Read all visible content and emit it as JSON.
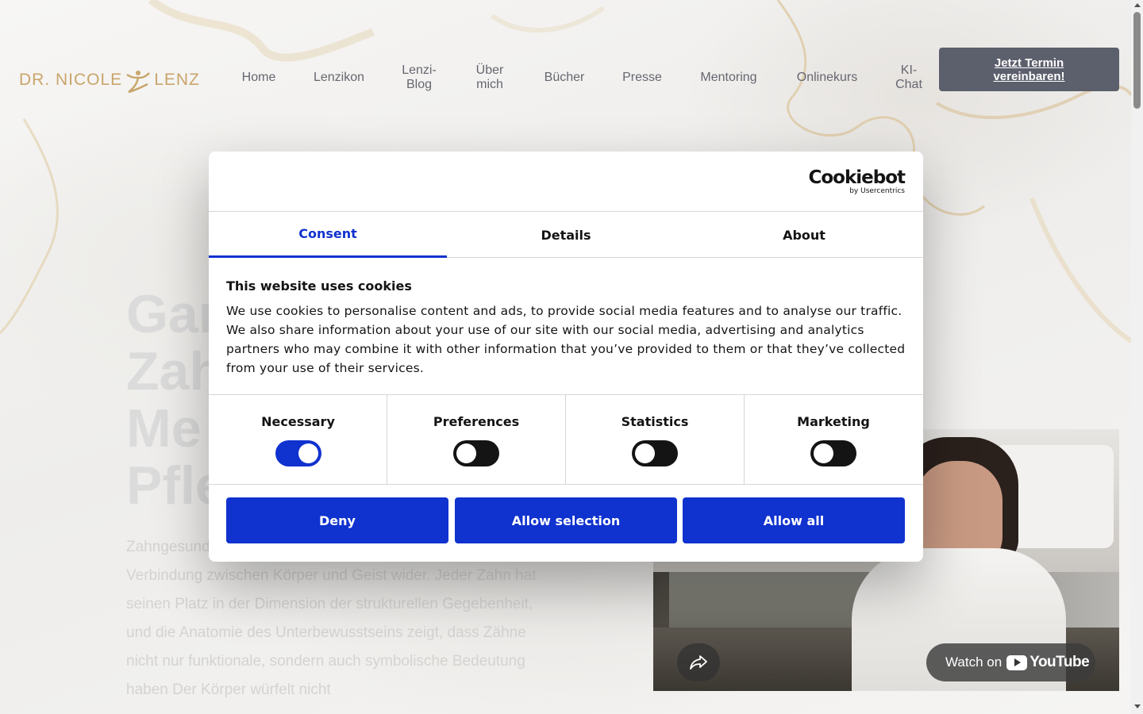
{
  "header": {
    "logo_text_left": "DR. NICOLE",
    "logo_text_right": "LENZ",
    "nav": [
      {
        "label": "Home"
      },
      {
        "label": "Lenzikon"
      },
      {
        "label": "Lenzi-Blog"
      },
      {
        "label": "Über mich"
      },
      {
        "label": "Bücher"
      },
      {
        "label": "Presse"
      },
      {
        "label": "Mentoring"
      },
      {
        "label": "Onlinekurs"
      },
      {
        "label": "KI-Chat"
      }
    ],
    "cta_label": "Jetzt Termin vereinbaren!"
  },
  "hero": {
    "title_lines": [
      "Gan",
      "Zah",
      "Me",
      "Pfle"
    ],
    "text": "Zahngesund allgemeinen Gesundheit und spiegelt die Verbindung zwischen Körper und Geist wider. Jeder Zahn hat seinen Platz in der Dimension der strukturellen Gegebenheit, und die Anatomie des Unterbewusstseins zeigt, dass Zähne nicht nur funktionale, sondern auch symbolische Bedeutung haben Der Körper würfelt nicht"
  },
  "video": {
    "watch_label": "Watch on",
    "youtube_label": "YouTube"
  },
  "cookie_dialog": {
    "brand": "Cookiebot",
    "brand_sub": "by Usercentrics",
    "tabs": [
      {
        "label": "Consent",
        "active": true
      },
      {
        "label": "Details",
        "active": false
      },
      {
        "label": "About",
        "active": false
      }
    ],
    "title": "This website uses cookies",
    "text": "We use cookies to personalise content and ads, to provide social media features and to analyse our traffic. We also share information about your use of our site with our social media, advertising and analytics partners who may combine it with other information that you’ve provided to them or that they’ve collected from your use of their services.",
    "toggles": [
      {
        "label": "Necessary",
        "on": true
      },
      {
        "label": "Preferences",
        "on": false
      },
      {
        "label": "Statistics",
        "on": false
      },
      {
        "label": "Marketing",
        "on": false
      }
    ],
    "buttons": {
      "deny": "Deny",
      "allow_selection": "Allow selection",
      "allow_all": "Allow all"
    }
  },
  "colors": {
    "accent": "#1032cf",
    "cta_bg": "#5c5f6c",
    "logo_gold": "#c9a56b"
  }
}
